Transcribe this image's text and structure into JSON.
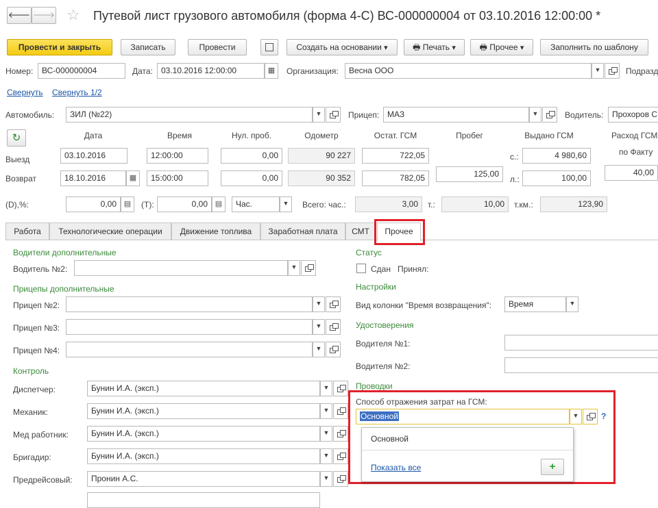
{
  "header": {
    "title": "Путевой лист грузового автомобиля (форма 4-С) ВС-000000004 от 03.10.2016 12:00:00 *",
    "back_icon": "arrow-left-icon",
    "forward_icon": "arrow-right-icon",
    "star_icon": "star-icon"
  },
  "toolbar": {
    "post_close": "Провести и закрыть",
    "save": "Записать",
    "post": "Провести",
    "create_based": "Создать на основании",
    "print": "Печать",
    "other": "Прочее",
    "fill_template": "Заполнить по шаблону"
  },
  "doc": {
    "number_label": "Номер:",
    "number": "ВС-000000004",
    "date_label": "Дата:",
    "date": "03.10.2016 12:00:00",
    "org_label": "Организация:",
    "org": "Весна ООО",
    "unit_label": "Подразд"
  },
  "links": {
    "collapse": "Свернуть",
    "collapse_half": "Свернуть 1/2"
  },
  "vehicle": {
    "car_label": "Автомобиль:",
    "car": "ЗИЛ (№22)",
    "trailer_label": "Прицеп:",
    "trailer": "МАЗ",
    "driver_label": "Водитель:",
    "driver": "Прохоров С"
  },
  "grid": {
    "headers": {
      "date": "Дата",
      "time": "Время",
      "zero_run": "Нул. проб.",
      "odometer": "Одометр",
      "fuel_left": "Остат. ГСМ",
      "mileage": "Пробег",
      "fuel_issued": "Выдано ГСМ",
      "fuel_use_1": "Расход ГСМ",
      "fuel_use_2": "по Факту"
    },
    "departure": {
      "label": "Выезд",
      "date": "03.10.2016",
      "time": "12:00:00",
      "zero_run": "0,00",
      "odometer": "90 227",
      "fuel": "722,05",
      "issued_prefix": "с.:",
      "issued": "4 980,60"
    },
    "return": {
      "label": "Возврат",
      "date": "18.10.2016",
      "time": "15:00:00",
      "zero_run": "0,00",
      "odometer": "90 352",
      "fuel": "782,05",
      "issued_prefix": "л.:",
      "issued": "100,00"
    },
    "mileage": "125,00",
    "fuel_use": "40,00"
  },
  "totals": {
    "d_label": "(D),%:",
    "d_value": "0,00",
    "t_label": "(T):",
    "t_value": "0,00",
    "unit": "Час.",
    "hours_label": "Всего: час.:",
    "hours": "3,00",
    "tons_label": "т.:",
    "tons": "10,00",
    "tkm_label": "т.км.:",
    "tkm": "123,90"
  },
  "tabs": [
    "Работа",
    "Технологические операции",
    "Движение топлива",
    "Заработная плата",
    "СМТ",
    "Прочее"
  ],
  "left": {
    "extra_drivers": "Водители дополнительные",
    "driver2_label": "Водитель №2:",
    "extra_trailers": "Прицепы дополнительные",
    "trailer2_label": "Прицеп №2:",
    "trailer3_label": "Прицеп №3:",
    "trailer4_label": "Прицеп №4:",
    "control": "Контроль",
    "dispatcher_label": "Диспетчер:",
    "dispatcher": "Бунин И.А. (эксп.)",
    "mechanic_label": "Механик:",
    "mechanic": "Бунин И.А. (эксп.)",
    "medic_label": "Мед работник:",
    "medic": "Бунин И.А. (эксп.)",
    "brigadier_label": "Бригадир:",
    "brigadier": "Бунин И.А. (эксп.)",
    "pretrip_label": "Предрейсовый:",
    "pretrip": "Пронин А.С."
  },
  "right": {
    "status": "Статус",
    "handed": "Сдан",
    "accepted": "Принял:",
    "settings": "Настройки",
    "return_col_label": "Вид колонки \"Время возвращения\":",
    "return_col": "Время",
    "certificates": "Удостоверения",
    "driver1_label": "Водителя №1:",
    "driver2_label": "Водителя №2:",
    "postings": "Проводки",
    "fuel_cost_label": "Способ отражения затрат на ГСМ:",
    "fuel_cost_value": "Основной",
    "help": "?",
    "popup_option": "Основной",
    "show_all": "Показать все"
  },
  "colors": {
    "accent": "#f7d328",
    "section": "#3a8a3a",
    "highlight": "#e0202a",
    "link": "#1a56a8"
  }
}
